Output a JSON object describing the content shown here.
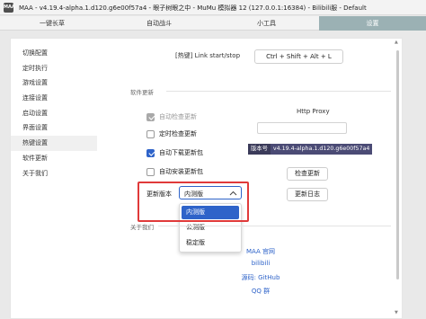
{
  "window": {
    "app_icon_text": "MAA",
    "title": "MAA - v4.19.4-alpha.1.d120.g6e00f57a4 - 眼子树眼之中 - MuMu 模拟器 12 (127.0.0.1:16384) - Bilibili服 - Default"
  },
  "tabs": [
    {
      "label": "一键长草"
    },
    {
      "label": "自动战斗"
    },
    {
      "label": "小工具"
    },
    {
      "label": "设置"
    }
  ],
  "sidebar": {
    "items": [
      {
        "label": "切换配置"
      },
      {
        "label": "定时执行"
      },
      {
        "label": "游戏设置"
      },
      {
        "label": "连接设置"
      },
      {
        "label": "启动设置"
      },
      {
        "label": "界面设置"
      },
      {
        "label": "热键设置"
      },
      {
        "label": "软件更新"
      },
      {
        "label": "关于我们"
      }
    ]
  },
  "hotkey": {
    "label": "[热键] Link start/stop",
    "value": "Ctrl + Shift + Alt + L"
  },
  "update": {
    "section_title": "软件更新",
    "auto_check": "自动检查更新",
    "scheduled_check": "定时检查更新",
    "auto_download": "自动下载更新包",
    "auto_install": "自动安装更新包",
    "proxy_label": "Http Proxy",
    "proxy_value": "",
    "version_key": "版本号",
    "version_value": "v4.19.4-alpha.1.d120.g6e00f57a4",
    "check_button": "检查更新",
    "log_button": "更新日志",
    "version_type_label": "更新版本",
    "version_type_value": "内测版",
    "version_type_options": [
      "内测版",
      "公测版",
      "稳定版"
    ]
  },
  "about": {
    "section_title": "关于我们",
    "links": [
      "MAA 官网",
      "bilibili",
      "源码: GitHub",
      "QQ 群"
    ]
  },
  "colors": {
    "accent": "#2e63c9",
    "highlight": "#e03a3a",
    "active_tab": "#9bb1b4"
  }
}
